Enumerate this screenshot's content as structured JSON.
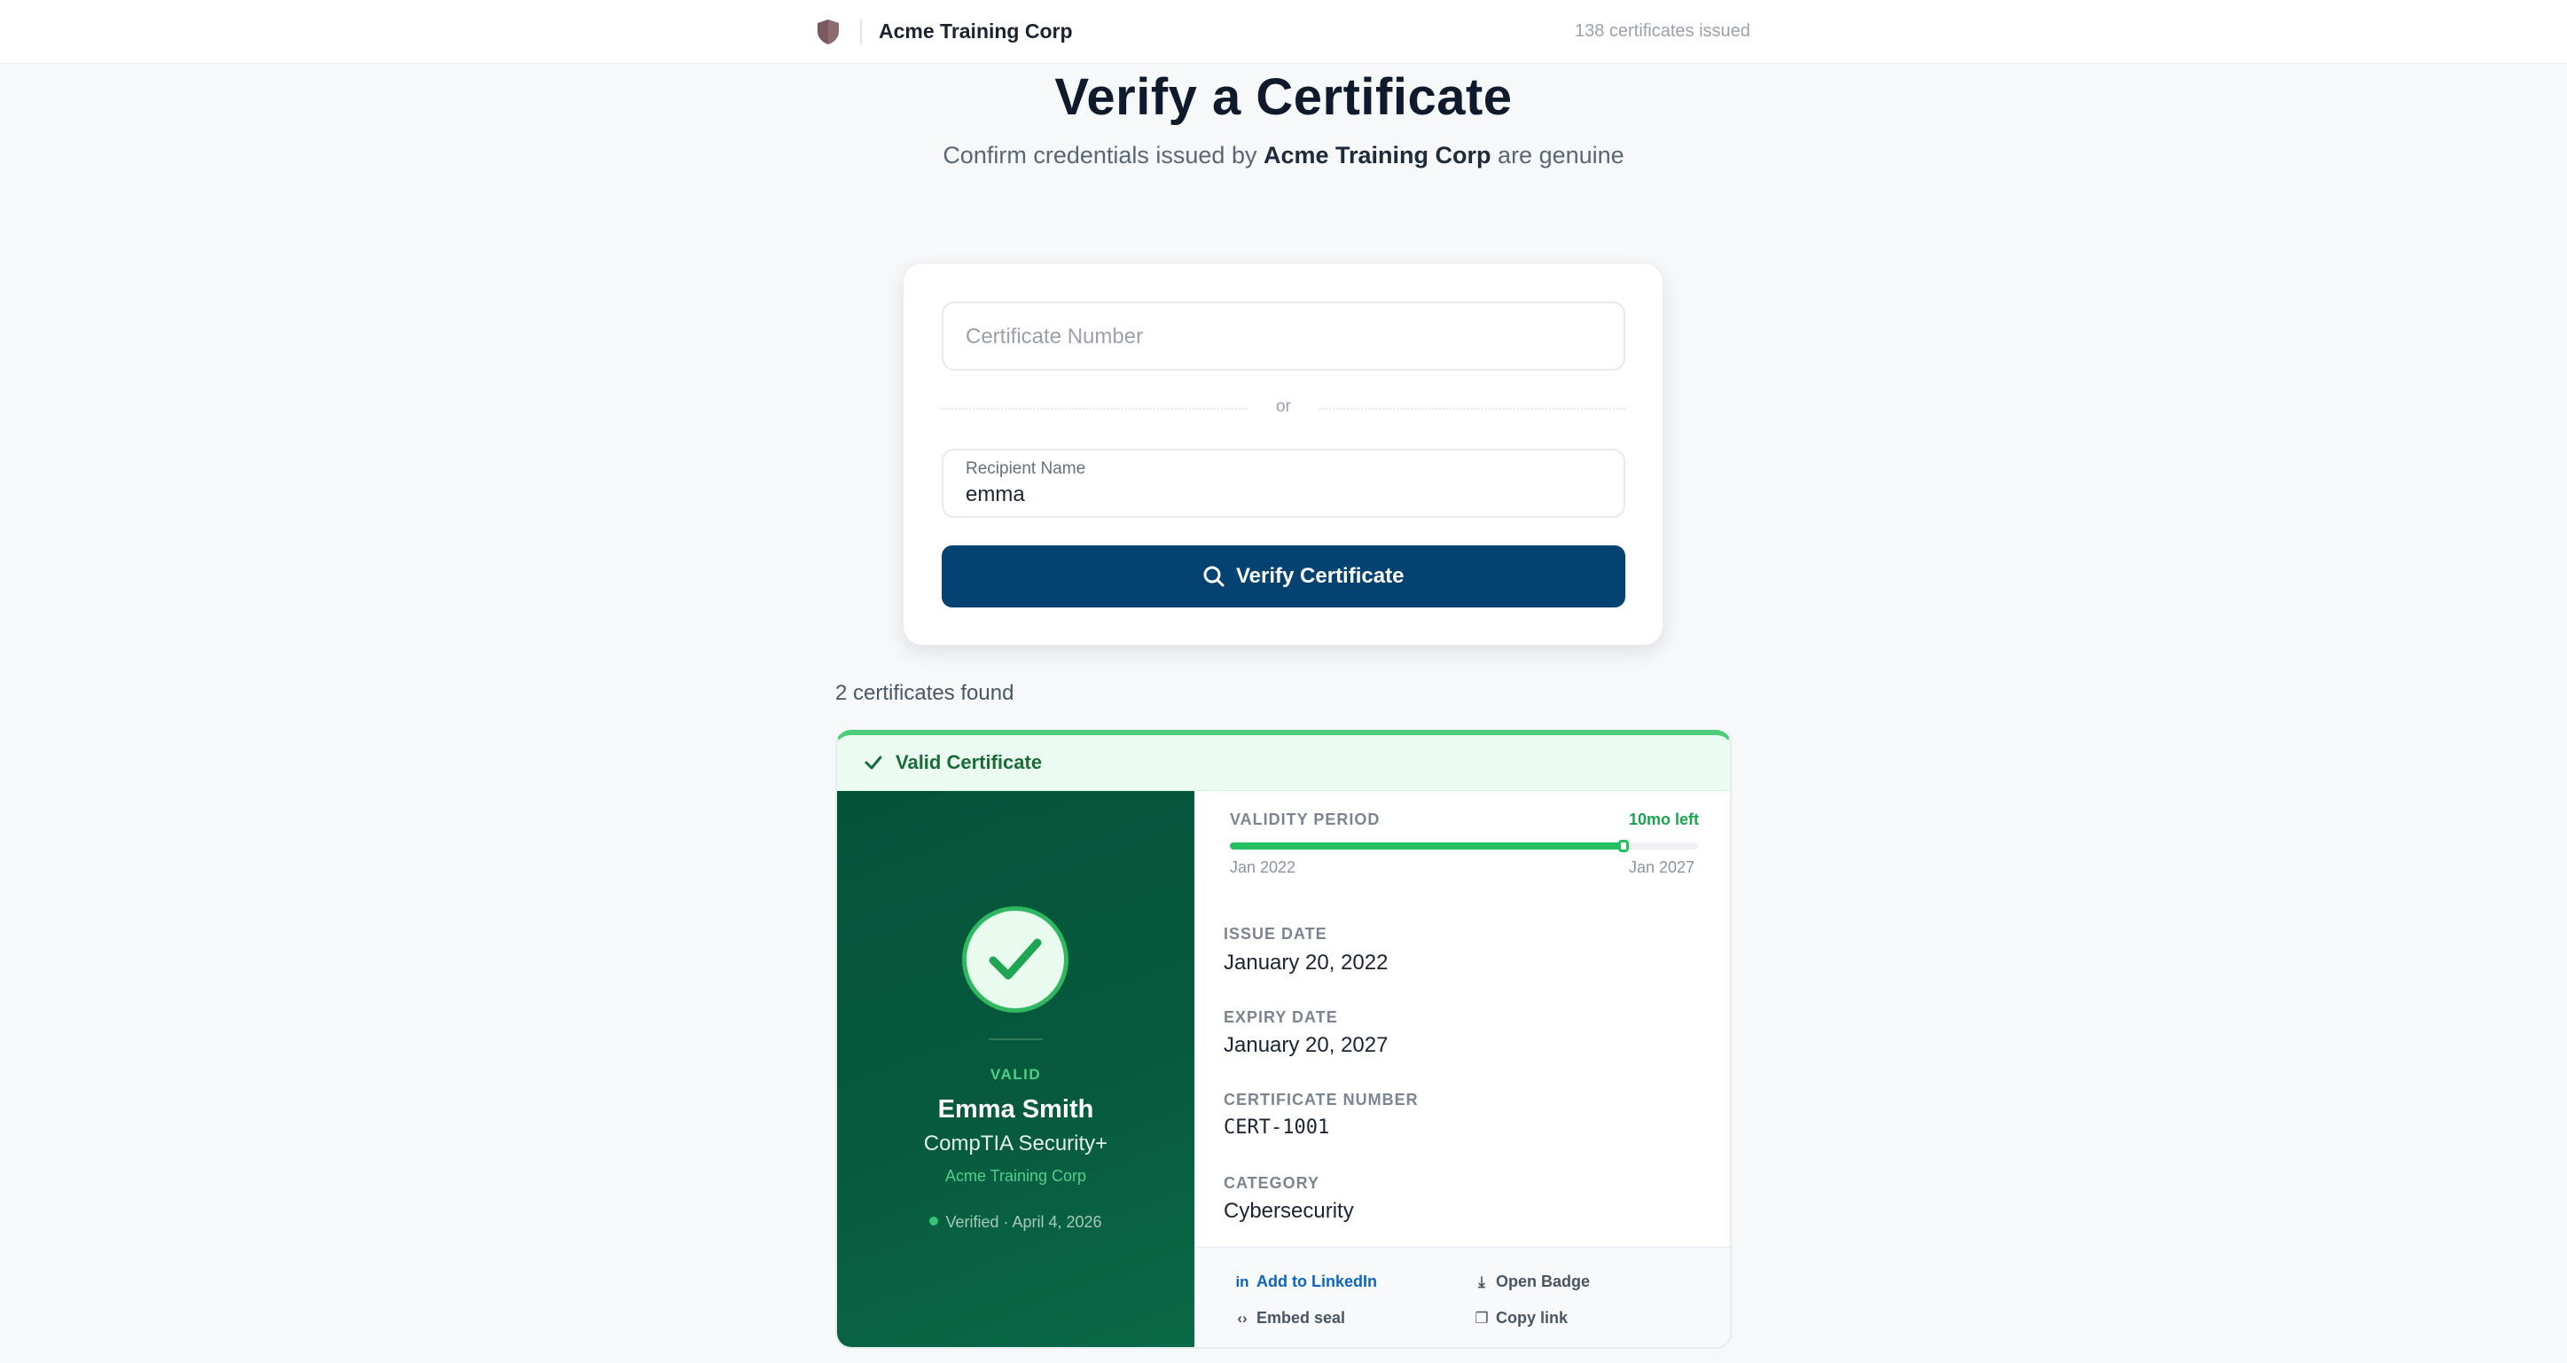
{
  "header": {
    "brand": "Acme Training Corp",
    "issued_count": "138 certificates issued",
    "logo_icon": "shield-icon"
  },
  "hero": {
    "title": "Verify a Certificate",
    "subtitle_prefix": "Confirm credentials issued by",
    "subtitle_org": "Acme Training Corp",
    "subtitle_suffix": "are genuine"
  },
  "form": {
    "certificate_number_placeholder": "Certificate Number",
    "certificate_number_value": "",
    "or_text": "or",
    "recipient_label": "Recipient Name",
    "recipient_value": "emma",
    "verify_button": "Verify Certificate",
    "verify_icon": "search-icon"
  },
  "results": {
    "found_text": "2 certificates found",
    "certificate": {
      "banner": "Valid Certificate",
      "status": "VALID",
      "recipient": "Emma Smith",
      "course": "CompTIA Security+",
      "issuer": "Acme Training Corp",
      "verified": "Verified · April 4, 2026",
      "validity": {
        "label": "VALIDITY PERIOD",
        "remaining": "10mo left",
        "start": "Jan 2022",
        "end": "Jan 2027",
        "elapsed_fraction": 0.84
      },
      "fields": {
        "issue_date_label": "ISSUE DATE",
        "issue_date": "January 20, 2022",
        "expiry_date_label": "EXPIRY DATE",
        "expiry_date": "January 20, 2027",
        "cert_number_label": "CERTIFICATE NUMBER",
        "cert_number": "CERT-1001",
        "category_label": "CATEGORY",
        "category": "Cybersecurity"
      },
      "actions": {
        "linkedin": "Add to LinkedIn",
        "open_badge": "Open Badge",
        "embed_seal": "Embed seal",
        "copy_link": "Copy link"
      }
    }
  },
  "colors": {
    "primary": "#044272",
    "valid_green": "#26c061",
    "panel_green": "#04543a",
    "linkedin_blue": "#0a66c2"
  }
}
